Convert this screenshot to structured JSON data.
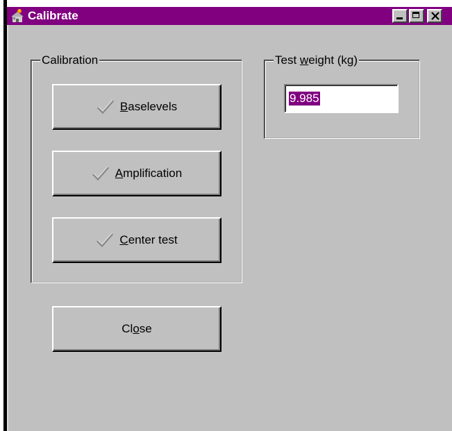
{
  "window": {
    "title": "Calibrate",
    "colors": {
      "titlebar": "#800080",
      "face": "#c0c0c0",
      "selection": "#800080"
    }
  },
  "calibration_group": {
    "legend": "Calibration",
    "buttons": [
      {
        "prefix": "",
        "accel": "B",
        "rest": "aselevels",
        "icon": "checkmark-icon"
      },
      {
        "prefix": "",
        "accel": "A",
        "rest": "mplification",
        "icon": "checkmark-icon"
      },
      {
        "prefix": "",
        "accel": "C",
        "rest": "enter test",
        "icon": "checkmark-icon"
      }
    ]
  },
  "test_weight_group": {
    "legend_prefix": "Test ",
    "legend_accel": "w",
    "legend_rest": "eight (kg)",
    "value": "9.985"
  },
  "close_button": {
    "prefix": "Cl",
    "accel": "o",
    "rest": "se"
  }
}
